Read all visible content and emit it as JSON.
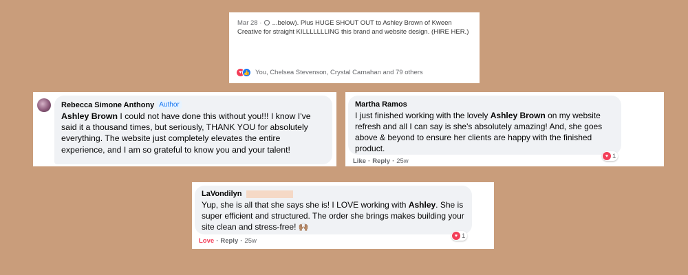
{
  "card1": {
    "date": "Mar 28",
    "sep": " · ",
    "text": " ...below). Plus HUGE SHOUT OUT to Ashley Brown of Kween Creative for straight KILLLLLLLING this brand and website design. (HIRE HER.)",
    "reactions": "You, Chelsea Stevenson, Crystal Carnahan and 79 others"
  },
  "card2": {
    "name": "Rebecca Simone Anthony",
    "badge": "Author",
    "bold": "Ashley Brown",
    "text": " I could not have done this without you!!! I know I've said it a thousand times, but seriously, THANK YOU for absolutely everything. The website just completely elevates the entire experience, and I am so grateful to know you and your talent!"
  },
  "card3": {
    "name": "Martha Ramos",
    "text_before": "I just finished working with the lovely ",
    "bold": "Ashley Brown",
    "text_after": " on my website refresh and all I can say is she's absolutely amazing! And, she goes above & beyond to ensure her clients are happy with the finished product.",
    "like": "Like",
    "reply": "Reply",
    "time": "25w",
    "count": "1"
  },
  "card4": {
    "name": "LaVondilyn",
    "text_before": "Yup, she is all that she says she is! I LOVE working with ",
    "bold": "Ashley",
    "text_after": ". She is super efficient and structured. The order she brings makes building your site clean and stress-free! 🙌🏽",
    "love": "Love",
    "reply": "Reply",
    "time": "25w",
    "count": "1"
  },
  "colors": {
    "background": "#c99d7b",
    "bubble": "#f0f2f5",
    "heart": "#f33e58",
    "like_blue": "#1877f2"
  },
  "icons": [
    "globe-icon",
    "heart-reaction-icon",
    "like-reaction-icon",
    "avatar"
  ]
}
